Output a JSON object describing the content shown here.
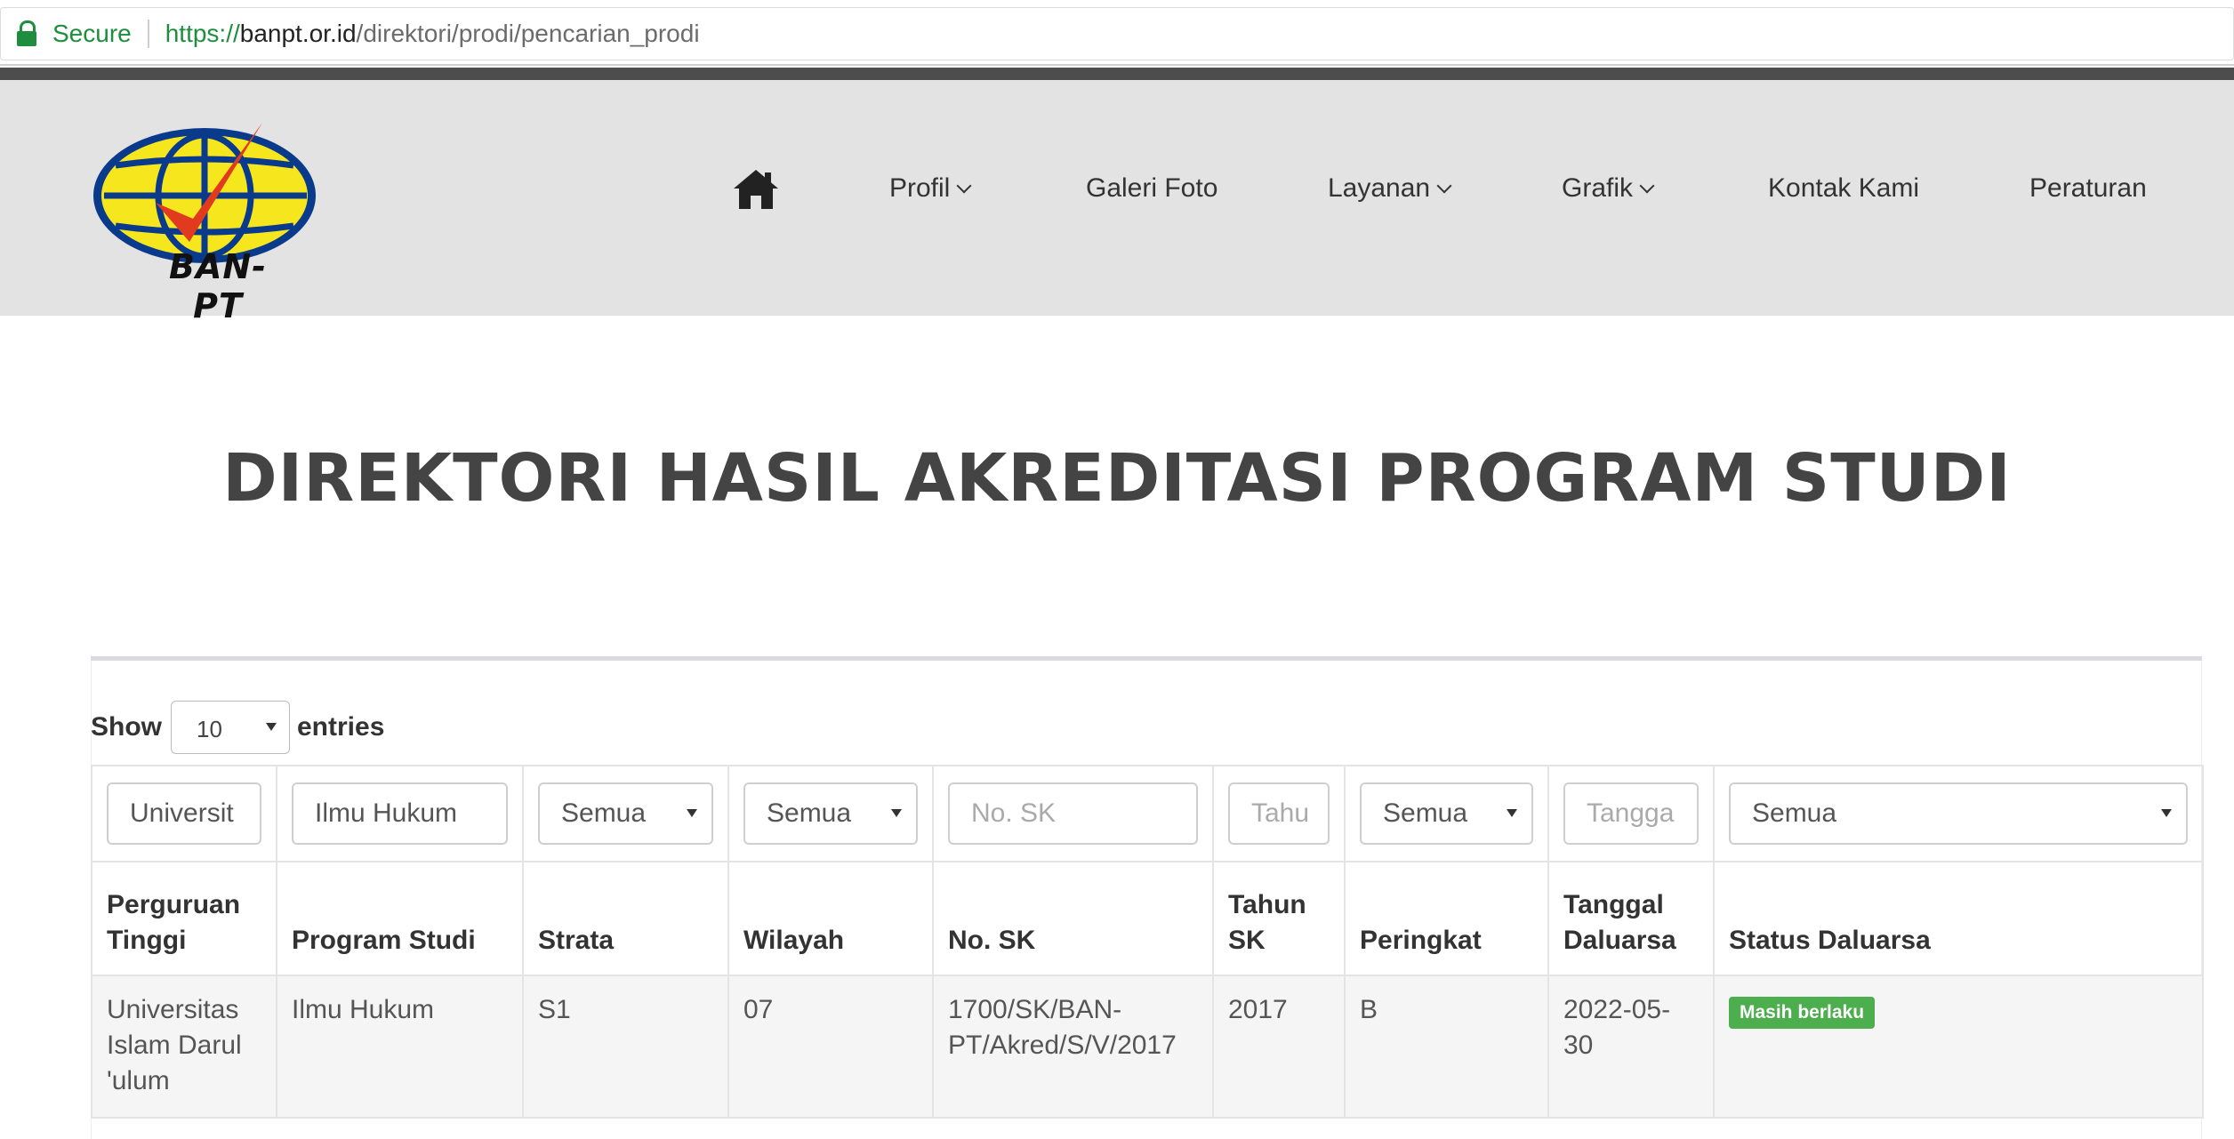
{
  "browser": {
    "secure_label": "Secure",
    "url_scheme": "https://",
    "url_host": "banpt.or.id",
    "url_path": "/direktori/prodi/pencarian_prodi"
  },
  "logo": {
    "text": "BAN-PT"
  },
  "nav": {
    "home_icon": "home-icon",
    "items": [
      {
        "label": "Profil",
        "has_dropdown": true
      },
      {
        "label": "Galeri Foto",
        "has_dropdown": false
      },
      {
        "label": "Layanan",
        "has_dropdown": true
      },
      {
        "label": "Grafik",
        "has_dropdown": true
      },
      {
        "label": "Kontak Kami",
        "has_dropdown": false
      },
      {
        "label": "Peraturan",
        "has_dropdown": false
      }
    ]
  },
  "page": {
    "title": "DIREKTORI HASIL AKREDITASI PROGRAM STUDI"
  },
  "table_controls": {
    "show_label": "Show",
    "entries_value": "10",
    "entries_label": "entries"
  },
  "filters": [
    {
      "type": "input",
      "value": "Universit",
      "placeholder": ""
    },
    {
      "type": "input",
      "value": "Ilmu Hukum",
      "placeholder": ""
    },
    {
      "type": "select",
      "value": "Semua"
    },
    {
      "type": "select",
      "value": "Semua"
    },
    {
      "type": "input",
      "value": "",
      "placeholder": "No. SK"
    },
    {
      "type": "input",
      "value": "",
      "placeholder": "Tahu"
    },
    {
      "type": "select",
      "value": "Semua"
    },
    {
      "type": "input",
      "value": "",
      "placeholder": "Tangga"
    },
    {
      "type": "select",
      "value": "Semua"
    }
  ],
  "columns": [
    [
      "Perguruan",
      "Tinggi"
    ],
    [
      "Program Studi"
    ],
    [
      "Strata"
    ],
    [
      "Wilayah"
    ],
    [
      "No. SK"
    ],
    [
      "Tahun",
      "SK"
    ],
    [
      "Peringkat"
    ],
    [
      "Tanggal",
      "Daluarsa"
    ],
    [
      "Status Daluarsa"
    ]
  ],
  "rows": [
    {
      "perguruan_tinggi": [
        "Universitas",
        "Islam Darul",
        "'ulum"
      ],
      "program_studi": "Ilmu Hukum",
      "strata": "S1",
      "wilayah": "07",
      "no_sk": [
        "1700/SK/BAN-",
        "PT/Akred/S/V/2017"
      ],
      "tahun_sk": "2017",
      "peringkat": "B",
      "tanggal_daluarsa": [
        "2022-05-",
        "30"
      ],
      "status": "Masih berlaku"
    }
  ],
  "colors": {
    "badge_green": "#4cae4c",
    "header_bg": "#e3e3e3",
    "secure_green": "#1e8e3e"
  }
}
